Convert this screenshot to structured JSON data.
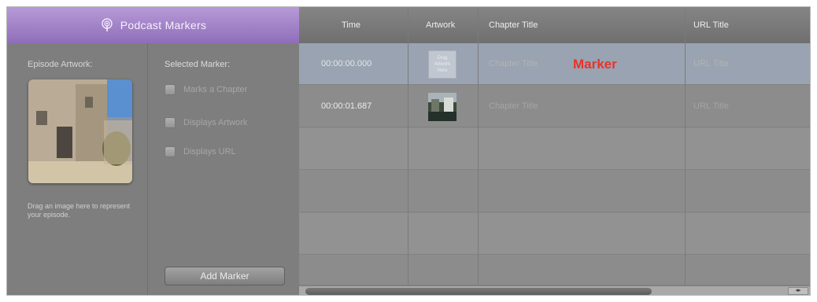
{
  "panel": {
    "title": "Podcast Markers",
    "episode_artwork_label": "Episode Artwork:",
    "artwork_help": "Drag an image here to represent your episode.",
    "selected_marker_label": "Selected Marker:",
    "checkboxes": [
      {
        "label": "Marks a Chapter",
        "checked": false
      },
      {
        "label": "Displays Artwork",
        "checked": false
      },
      {
        "label": "Displays URL",
        "checked": false
      }
    ],
    "add_marker_label": "Add Marker"
  },
  "table": {
    "columns": [
      "Time",
      "Artwork",
      "Chapter Title",
      "URL Title"
    ],
    "rows": [
      {
        "time": "00:00:00.000",
        "artwork": "Drag Artwork Here",
        "chapter_title": "Chapter Title",
        "url_title": "URL Title",
        "selected": true
      },
      {
        "time": "00:00:01.687",
        "artwork": "",
        "chapter_title": "Chapter Title",
        "url_title": "URL Title",
        "selected": false
      }
    ]
  },
  "annotation": {
    "label": "Marker",
    "color": "#e8332b"
  },
  "colors": {
    "header_purple": "#9d7fc8",
    "selected_row": "#9aa3b1"
  }
}
